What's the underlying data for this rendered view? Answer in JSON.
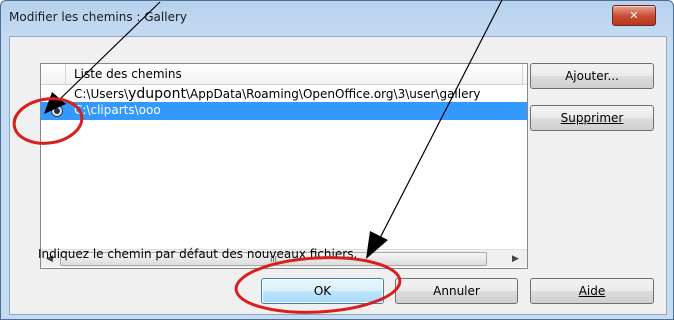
{
  "window": {
    "title": "Modifier les chemins : Gallery",
    "close_glyph": "✕"
  },
  "list": {
    "column_header": "Liste des chemins",
    "rows": [
      {
        "text_before": "C:\\Users\\",
        "text_bold": "ydupont",
        "text_after": "\\AppData\\Roaming\\OpenOffice.org\\3\\user\\gallery",
        "selected": false
      },
      {
        "text": "C:\\cliparts\\ooo",
        "selected": true,
        "default_radio": true
      }
    ],
    "scroll_left": "◀",
    "scroll_right": "▶",
    "scroll_thumb_grip": "III"
  },
  "buttons": {
    "add": "Ajouter...",
    "remove": "Supprimer",
    "ok": "OK",
    "cancel": "Annuler",
    "help": "Aide"
  },
  "hint": "Indiquez le chemin par défaut des nouveaux fichiers.",
  "colors": {
    "selection": "#3399ff",
    "annotation": "#d91e1e",
    "titlebar": "#c5dbf2",
    "close_button": "#c84a31"
  },
  "icons": {
    "close": "close-icon",
    "radio": "radio-icon"
  }
}
